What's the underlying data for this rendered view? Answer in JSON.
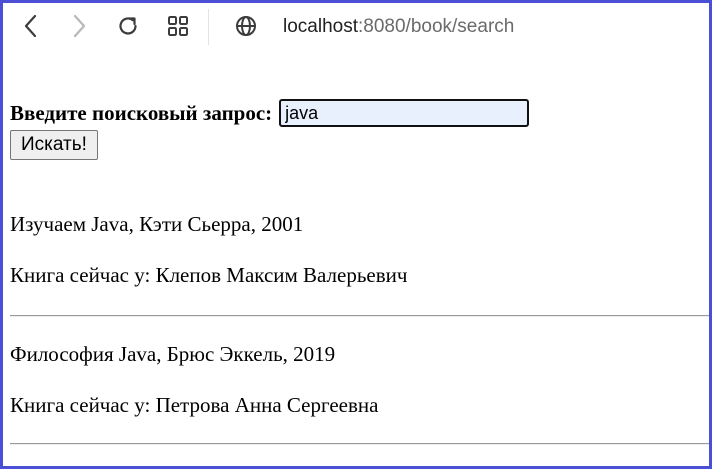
{
  "toolbar": {
    "back_icon": "arrow-left-icon",
    "forward_icon": "arrow-right-icon",
    "reload_icon": "reload-icon",
    "tabs_icon": "grid-icon",
    "site_icon": "globe-icon",
    "url_host": "localhost",
    "url_rest": ":8080/book/search"
  },
  "search": {
    "label": "Введите поисковый запрос:",
    "value": "java",
    "button_label": "Искать!"
  },
  "results": [
    {
      "book": "Изучаем Java, Кэти Сьерра, 2001",
      "holder": "Книга сейчас у: Клепов Максим Валерьевич"
    },
    {
      "book": "Философия Java, Брюс Эккель, 2019",
      "holder": "Книга сейчас у: Петрова Анна Сергеевна"
    }
  ],
  "colors": {
    "frame_border": "#4a4fd6",
    "input_background": "#e8f0fe"
  }
}
